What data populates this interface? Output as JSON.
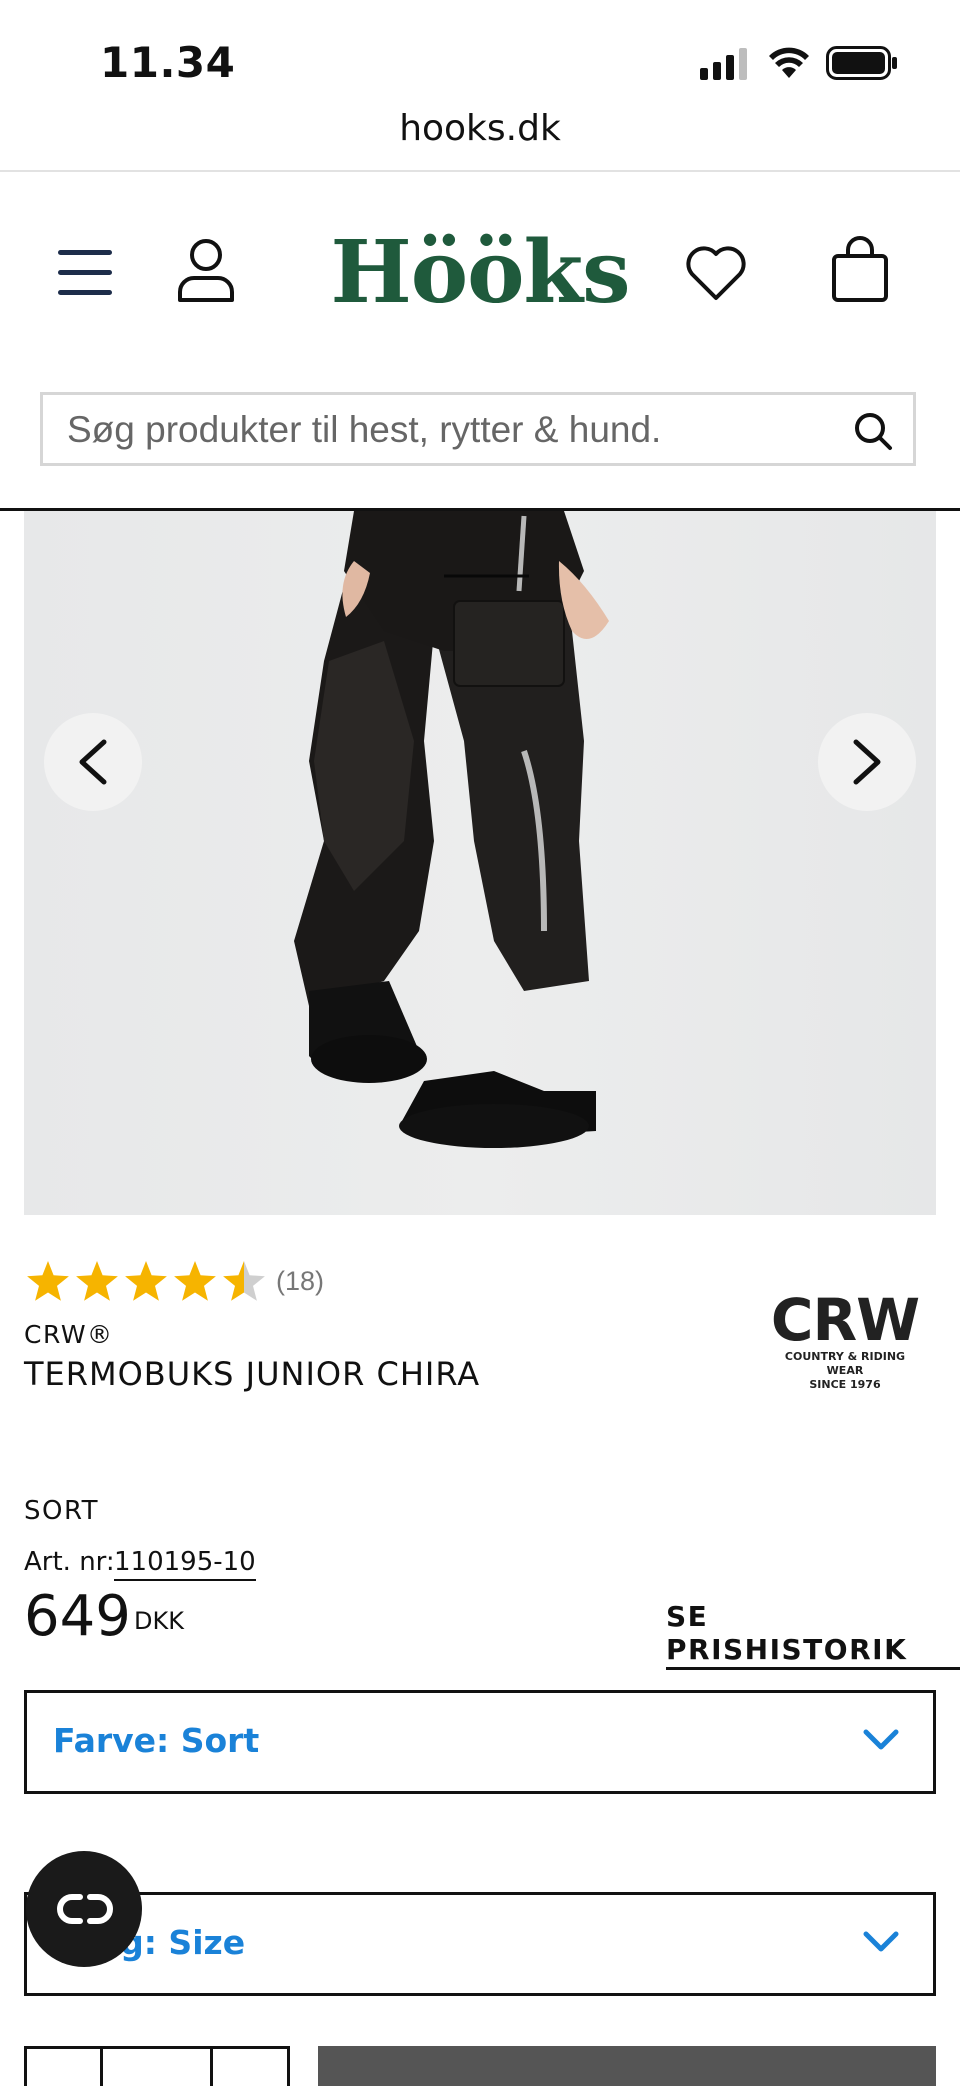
{
  "status_bar": {
    "time": "11.34",
    "signal_icon": "signal-bars-icon",
    "wifi_icon": "wifi-icon",
    "battery_icon": "battery-icon"
  },
  "browser": {
    "url": "hooks.dk"
  },
  "header": {
    "logo_text": "Hööks",
    "menu_icon": "hamburger-menu-icon",
    "account_icon": "user-icon",
    "wishlist_icon": "heart-icon",
    "cart_icon": "shopping-bag-icon",
    "brand_color": "#1f5a3c"
  },
  "search": {
    "placeholder": "Søg produkter til hest, rytter & hund.",
    "icon": "search-icon"
  },
  "gallery": {
    "prev_icon": "chevron-left-icon",
    "next_icon": "chevron-right-icon"
  },
  "product": {
    "rating": 4.5,
    "rating_max": 5,
    "review_count": "(18)",
    "brand": "CRW®",
    "title": "TERMOBUKS JUNIOR CHIRA",
    "brand_logo": {
      "word": "CRW",
      "tagline_1": "COUNTRY & RIDING WEAR",
      "tagline_2": "SINCE 1976"
    },
    "color_name": "SORT",
    "article_label": "Art. nr:",
    "article_number": "110195-10",
    "price": "649",
    "currency": "DKK",
    "price_history_link": "SE PRISHISTORIK"
  },
  "selectors": {
    "color_select": "Farve: Sort",
    "size_select": "Strlg: Size"
  },
  "colors": {
    "accent_blue": "#1a82d8",
    "star_gold": "#f6b400",
    "star_empty": "#cfcfcf"
  }
}
